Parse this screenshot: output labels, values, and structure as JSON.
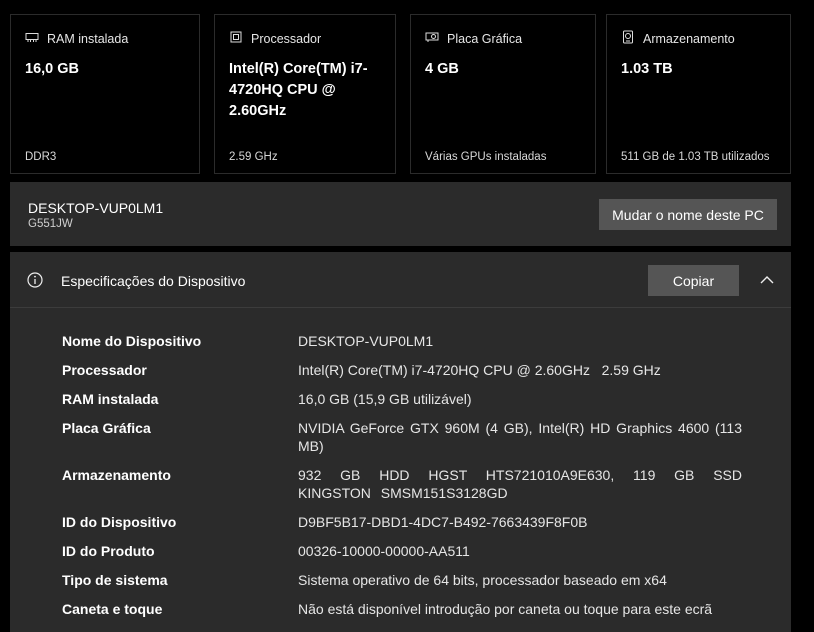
{
  "cards": [
    {
      "title": "RAM instalada",
      "icon": "ram-icon",
      "value": "16,0 GB",
      "footer": "DDR3"
    },
    {
      "title": "Processador",
      "icon": "processor-icon",
      "value": "Intel(R) Core(TM) i7-4720HQ CPU @ 2.60GHz",
      "footer": "2.59 GHz"
    },
    {
      "title": "Placa Gráfica",
      "icon": "graphics-card-icon",
      "value": "4 GB",
      "footer": "Várias GPUs instaladas"
    },
    {
      "title": "Armazenamento",
      "icon": "storage-icon",
      "value": "1.03 TB",
      "footer": "511 GB de 1.03 TB utilizados"
    }
  ],
  "pc": {
    "name": "DESKTOP-VUP0LM1",
    "model": "G551JW",
    "rename_label": "Mudar o nome deste PC"
  },
  "specs": {
    "title": "Especificações do Dispositivo",
    "copy_label": "Copiar",
    "rows": [
      {
        "label": "Nome do Dispositivo",
        "value": "DESKTOP-VUP0LM1"
      },
      {
        "label": "Processador",
        "value": "Intel(R) Core(TM) i7-4720HQ CPU @ 2.60GHz   2.59 GHz"
      },
      {
        "label": "RAM instalada",
        "value": "16,0 GB (15,9 GB utilizável)"
      },
      {
        "label": "Placa Gráfica",
        "value": "NVIDIA GeForce GTX 960M (4 GB), Intel(R) HD Graphics 4600 (113 MB)"
      },
      {
        "label": "Armazenamento",
        "value": "932 GB HDD HGST HTS721010A9E630, 119 GB SSD KINGSTON SMSM151S3128GD"
      },
      {
        "label": "ID do Dispositivo",
        "value": "D9BF5B17-DBD1-4DC7-B492-7663439F8F0B"
      },
      {
        "label": "ID do Produto",
        "value": "00326-10000-00000-AA511"
      },
      {
        "label": "Tipo de sistema",
        "value": "Sistema operativo de 64 bits, processador baseado em x64"
      },
      {
        "label": "Caneta e toque",
        "value": "Não está disponível introdução por caneta ou toque para este ecrã"
      }
    ]
  },
  "colors": {
    "background": "#000000",
    "panel": "#2b2b2b",
    "button": "#555555",
    "text": "#ffffff"
  }
}
